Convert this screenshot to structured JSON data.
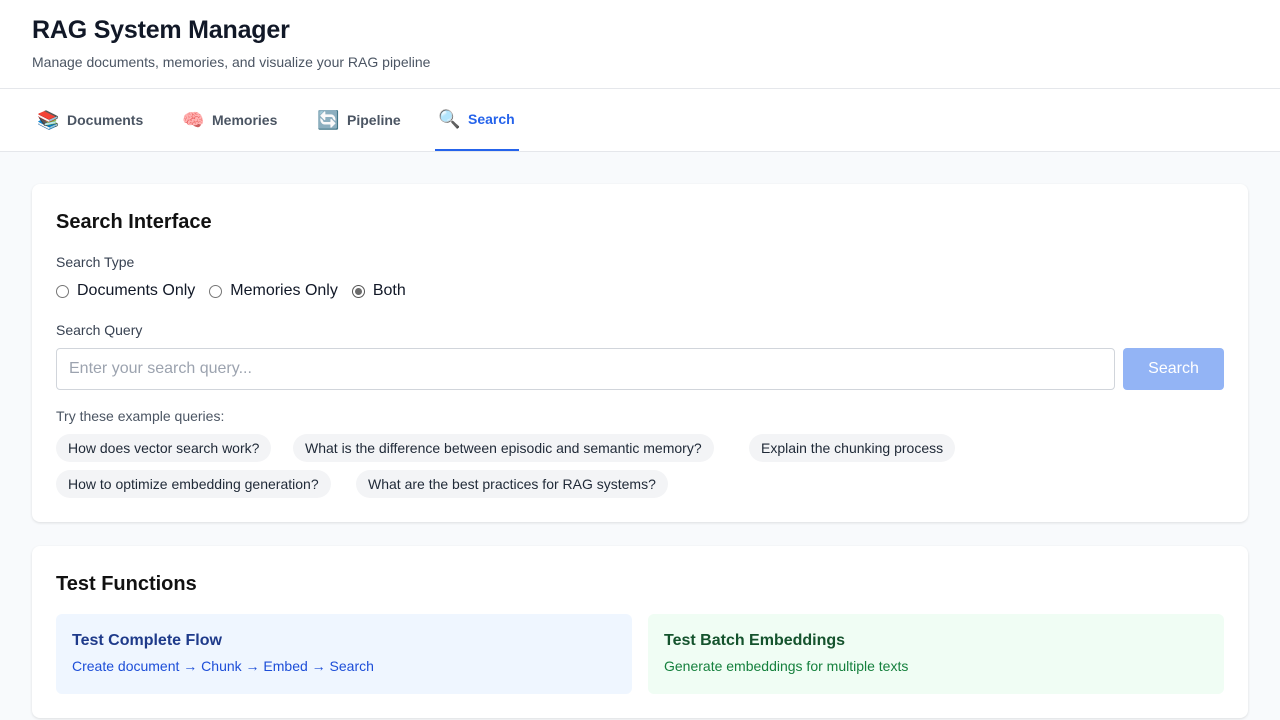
{
  "header": {
    "title": "RAG System Manager",
    "subtitle": "Manage documents, memories, and visualize your RAG pipeline"
  },
  "tabs": [
    {
      "label": "Documents",
      "icon": "books-icon",
      "glyph": "📚",
      "active": false
    },
    {
      "label": "Memories",
      "icon": "brain-icon",
      "glyph": "🧠",
      "active": false
    },
    {
      "label": "Pipeline",
      "icon": "refresh-icon",
      "glyph": "🔄",
      "active": false
    },
    {
      "label": "Search",
      "icon": "magnifier-icon",
      "glyph": "🔍",
      "active": true
    }
  ],
  "search": {
    "title": "Search Interface",
    "type_label": "Search Type",
    "types": [
      {
        "label": "Documents Only",
        "checked": false
      },
      {
        "label": "Memories Only",
        "checked": false
      },
      {
        "label": "Both",
        "checked": true
      }
    ],
    "query_label": "Search Query",
    "query_value": "",
    "placeholder": "Enter your search query...",
    "button_label": "Search",
    "examples_label": "Try these example queries:",
    "examples": [
      "How does vector search work?",
      "What is the difference between episodic and semantic memory?",
      "Explain the chunking process",
      "How to optimize embedding generation?",
      "What are the best practices for RAG systems?"
    ]
  },
  "tests": {
    "title": "Test Functions",
    "items": [
      {
        "title": "Test Complete Flow",
        "desc": "Create document → Chunk → Embed → Search"
      },
      {
        "title": "Test Batch Embeddings",
        "desc": "Generate embeddings for multiple texts"
      }
    ]
  },
  "colors": {
    "accent": "#2563eb",
    "search_button": "#93b4f5",
    "flow_bg": "#eff6ff",
    "batch_bg": "#f0fdf4"
  }
}
